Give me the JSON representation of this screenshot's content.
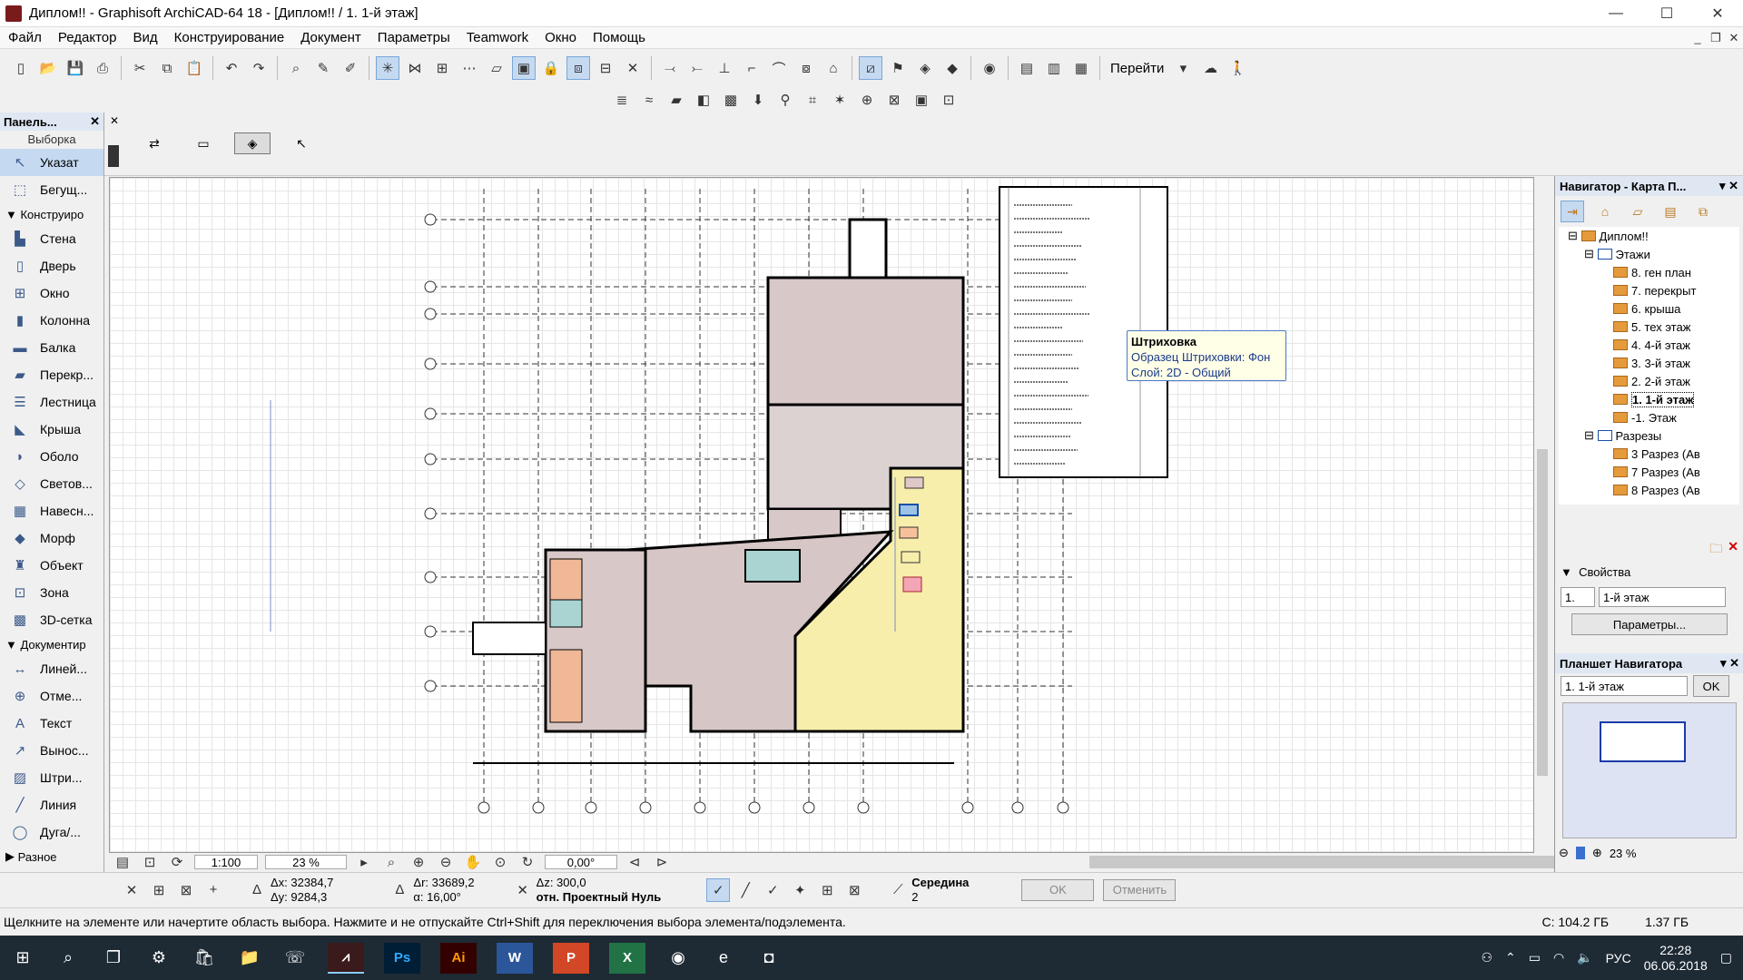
{
  "window": {
    "title": "Диплом!! - Graphisoft ArchiCAD-64 18 - [Диплом!! / 1. 1-й этаж]",
    "min": "—",
    "max": "☐",
    "close": "✕"
  },
  "menu": [
    "Файл",
    "Редактор",
    "Вид",
    "Конструирование",
    "Документ",
    "Параметры",
    "Teamwork",
    "Окно",
    "Помощь"
  ],
  "toolbar": {
    "goto_label": "Перейти"
  },
  "toolbox": {
    "title": "Панель...",
    "select_header": "Выборка",
    "pointer": "Указат",
    "marquee": "Бегущ...",
    "design_group": "Конструиро",
    "design_items": [
      "Стена",
      "Дверь",
      "Окно",
      "Колонна",
      "Балка",
      "Перекр...",
      "Лестница",
      "Крыша",
      "Оболо",
      "Светов...",
      "Навесн...",
      "Морф",
      "Объект",
      "Зона",
      "3D-сетка"
    ],
    "doc_group": "Документир",
    "doc_items": [
      "Линей...",
      "Отме...",
      "Текст",
      "Вынос...",
      "Штри...",
      "Линия",
      "Дуга/..."
    ],
    "misc_group": "Разное"
  },
  "tooltip": {
    "title": "Штриховка",
    "line1": "Образец Штриховки: Фон",
    "line2": "Слой: 2D - Общий"
  },
  "canvas_bar": {
    "scale": "1:100",
    "zoom": "23 %",
    "angle": "0,00°"
  },
  "navigator": {
    "title": "Навигатор - Карта П...",
    "tree": [
      {
        "label": "Диплом!!",
        "level": 0
      },
      {
        "label": "Этажи",
        "level": 1
      },
      {
        "label": "8. ген план",
        "level": 2
      },
      {
        "label": "7. перекрыт",
        "level": 2
      },
      {
        "label": "6. крыша",
        "level": 2
      },
      {
        "label": "5. тех этаж",
        "level": 2
      },
      {
        "label": "4. 4-й этаж",
        "level": 2
      },
      {
        "label": "3. 3-й этаж",
        "level": 2
      },
      {
        "label": "2. 2-й этаж",
        "level": 2
      },
      {
        "label": "1. 1-й этаж",
        "level": 2,
        "selected": true
      },
      {
        "label": "-1. Этаж",
        "level": 2
      },
      {
        "label": "Разрезы",
        "level": 1
      },
      {
        "label": "3 Разрез (Ав",
        "level": 2
      },
      {
        "label": "7 Разрез (Ав",
        "level": 2
      },
      {
        "label": "8 Разрез (Ав",
        "level": 2
      }
    ],
    "props_label": "Свойства",
    "prop_id": "1.",
    "prop_name": "1-й этаж",
    "params_btn": "Параметры..."
  },
  "planshet": {
    "title": "Планшет Навигатора",
    "story": "1. 1-й этаж",
    "ok": "OK",
    "zoom": "23 %"
  },
  "coords": {
    "dx": "Δx: 32384,7",
    "dy": "Δy: 9284,3",
    "dr": "Δr: 33689,2",
    "da": "α: 16,00°",
    "dz": "Δz: 300,0",
    "ref": "отн. Проектный Нуль",
    "snap": "Середина",
    "snap_n": "2",
    "ok": "OK",
    "cancel": "Отменить"
  },
  "status": {
    "text": "Щелкните на элементе или начертите область выбора. Нажмите и не отпускайте Ctrl+Shift для переключения выбора элемента/подэлемента.",
    "disk": "C: 104.2 ГБ",
    "mem": "1.37 ГБ"
  },
  "taskbar": {
    "apps": [
      "Ps",
      "Ai",
      "W",
      "P",
      "X"
    ],
    "lang": "РУС",
    "time": "22:28",
    "date": "06.06.2018"
  }
}
